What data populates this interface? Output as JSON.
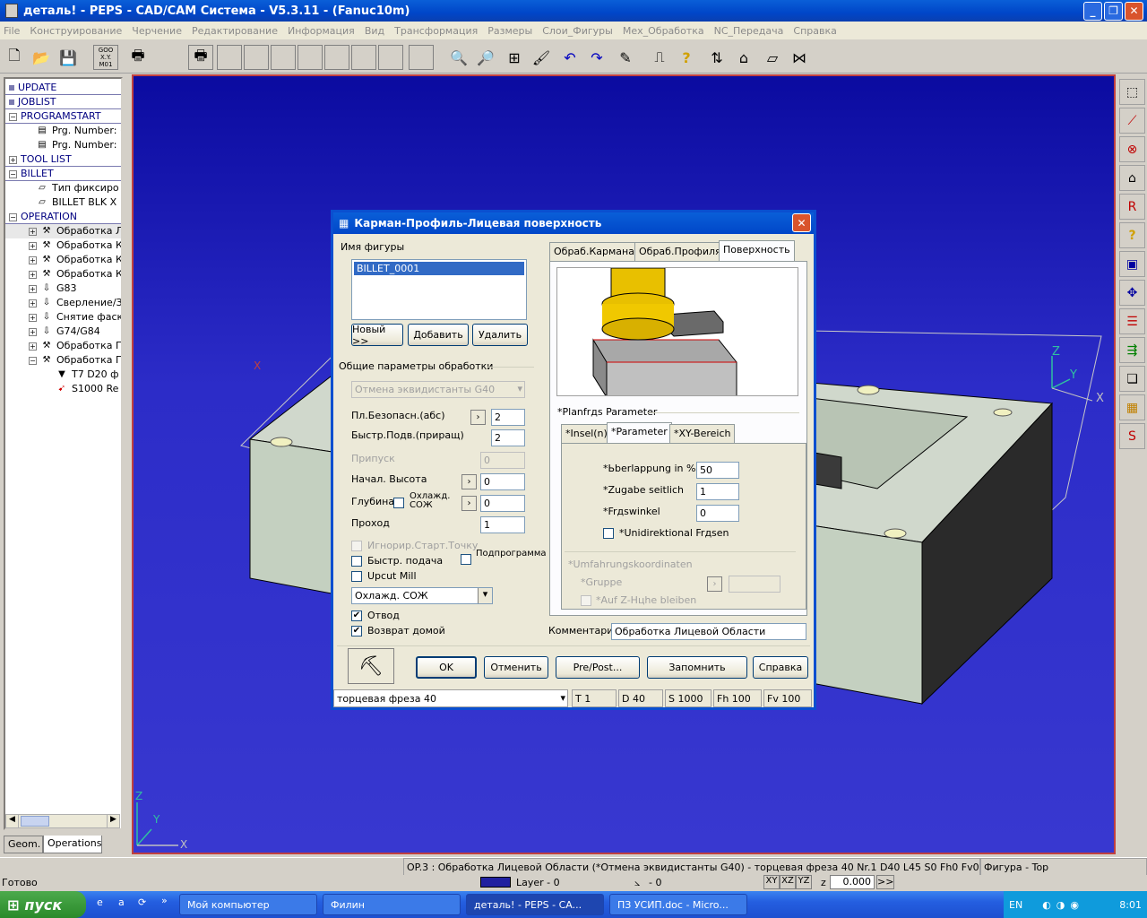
{
  "app": {
    "title": "деталь! - PEPS - CAD/CAM Система - V5.3.11 - (Fanuc10m)"
  },
  "menu": [
    "File",
    "Конструирование",
    "Черчение",
    "Редактирование",
    "Информация",
    "Вид",
    "Трансформация",
    "Размеры",
    "Слои_Фигуры",
    "Мех_Обработка",
    "NC_Передача",
    "Справка"
  ],
  "toolbar": {
    "goo_label": "GOO X.Y. M01"
  },
  "tree": {
    "items": [
      {
        "label": "UPDATE",
        "kind": "group"
      },
      {
        "label": "JOBLIST",
        "kind": "group"
      },
      {
        "label": "PROGRAMSTART",
        "kind": "group-open"
      },
      {
        "label": "Prg. Number: (",
        "kind": "child"
      },
      {
        "label": "Prg. Number: ",
        "kind": "child"
      },
      {
        "label": "TOOL LIST",
        "kind": "group"
      },
      {
        "label": "BILLET",
        "kind": "group-open"
      },
      {
        "label": "Тип фиксиро",
        "kind": "child"
      },
      {
        "label": "BILLET BLK X",
        "kind": "child"
      },
      {
        "label": "OPERATION",
        "kind": "group-open"
      },
      {
        "label": "Обработка Л",
        "kind": "op"
      },
      {
        "label": "Обработка К.",
        "kind": "op"
      },
      {
        "label": "Обработка К.",
        "kind": "op"
      },
      {
        "label": "Обработка К.",
        "kind": "op"
      },
      {
        "label": "G83",
        "kind": "op"
      },
      {
        "label": "Сверление/З",
        "kind": "op"
      },
      {
        "label": "Снятие фаск",
        "kind": "op"
      },
      {
        "label": "G74/G84",
        "kind": "op"
      },
      {
        "label": "Обработка П",
        "kind": "op"
      },
      {
        "label": "Обработка П",
        "kind": "op-open"
      },
      {
        "label": "T7 D20 ф",
        "kind": "sub"
      },
      {
        "label": "S1000 Re",
        "kind": "sub"
      }
    ],
    "tabs": [
      "Geom.",
      "Operations"
    ]
  },
  "dialog": {
    "title": "Карман-Профиль-Лицевая поверхность",
    "figure_name_label": "Имя фигуры",
    "figure_list": [
      "BILLET_0001"
    ],
    "btn_new": "Новый >>",
    "btn_add": "Добавить",
    "btn_delete": "Удалить",
    "general_params_label": "Общие параметры обработки",
    "cancel_equidist": "Отмена эквидистанты G40",
    "safe_plane_label": "Пл.Безопасн.(абс)",
    "safe_plane_value": "2",
    "rapid_feed_label": "Быстр.Подв.(приращ)",
    "rapid_feed_value": "2",
    "allowance_label": "Припуск",
    "allowance_value": "0",
    "start_height_label": "Начал. Высота",
    "start_height_value": "0",
    "depth_label": "Глубина",
    "coolant_small_label": "Охлажд. СОЖ",
    "depth_value": "0",
    "pass_label": "Проход",
    "pass_value": "1",
    "ignore_start_point": "Игнорир.Старт.Точку",
    "rapid_feed_check": "Быстр. подача",
    "subprogram": "Подпрограмма",
    "upcut_mill": "Upcut Mill",
    "coolant_select": "Охлажд. СОЖ",
    "retract": "Отвод",
    "return_home": "Возврат домой",
    "tabs": [
      "Обраб.Кармана",
      "Обраб.Профиля",
      "Поверхность"
    ],
    "planfrds_label": "*Planfrдs Parameter",
    "subtabs": [
      "*Insel(n)",
      "*Parameter",
      "*XY-Bereich"
    ],
    "overlap_label": "*Ьberlappung in %",
    "overlap_value": "50",
    "side_allowance_label": "*Zugabe seitlich",
    "side_allowance_value": "1",
    "mill_angle_label": "*Frдswinkel",
    "mill_angle_value": "0",
    "unidirectional_label": "*Unidirektional Frдsen",
    "bypass_label": "*Umfahrungskoordinaten",
    "group_label": "*Gruppe",
    "keep_z_label": "*Auf Z-Hцhe bleiben",
    "comment_label": "Комментарий",
    "comment_value": "Обработка Лицевой Области",
    "btn_ok": "OK",
    "btn_cancel": "Отменить",
    "btn_prepost": "Pre/Post...",
    "btn_remember": "Запомнить",
    "btn_help": "Справка",
    "tool_select": "торцевая фреза 40",
    "tool_t": "T 1",
    "tool_d": "D 40",
    "tool_s": "S 1000",
    "tool_fh": "Fh 100",
    "tool_fv": "Fv 100"
  },
  "viewport": {
    "axis_z": "Z",
    "axis_y": "Y",
    "axis_x": "X"
  },
  "status": {
    "op_text": "OP.3 : Обработка Лицевой Области (*Отмена эквидистанты G40)  -  торцевая фреза 40  Nr.1  D40  L45   S0 Fh0 Fv0",
    "figure_text": "Фигура  - Top",
    "ready": "Готово",
    "layer": "Layer - 0",
    "angle": "- 0",
    "xy": "XY",
    "xz": "XZ",
    "yz": "YZ",
    "z_label": "z",
    "z_value": "0.000",
    "more": ">>"
  },
  "taskbar": {
    "start": "пуск",
    "tasks": [
      "Мой компьютер",
      "Филин",
      "деталь! - PEPS - CA...",
      "ПЗ УСИП.doc - Micro..."
    ],
    "lang": "EN",
    "clock": "8:01"
  }
}
